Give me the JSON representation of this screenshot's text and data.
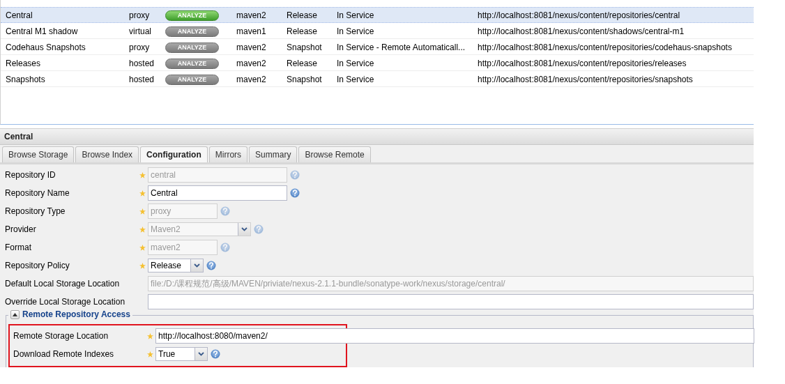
{
  "grid": {
    "rows": [
      {
        "name": "Central",
        "type": "proxy",
        "analyze": "ANALYZE",
        "format": "maven2",
        "policy": "Release",
        "status": "In Service",
        "url": "http://localhost:8081/nexus/content/repositories/central",
        "selected": true
      },
      {
        "name": "Central M1 shadow",
        "type": "virtual",
        "analyze": "ANALYZE",
        "format": "maven1",
        "policy": "Release",
        "status": "In Service",
        "url": "http://localhost:8081/nexus/content/shadows/central-m1",
        "selected": false
      },
      {
        "name": "Codehaus Snapshots",
        "type": "proxy",
        "analyze": "ANALYZE",
        "format": "maven2",
        "policy": "Snapshot",
        "status": "In Service - Remote Automaticall...",
        "url": "http://localhost:8081/nexus/content/repositories/codehaus-snapshots",
        "selected": false
      },
      {
        "name": "Releases",
        "type": "hosted",
        "analyze": "ANALYZE",
        "format": "maven2",
        "policy": "Release",
        "status": "In Service",
        "url": "http://localhost:8081/nexus/content/repositories/releases",
        "selected": false
      },
      {
        "name": "Snapshots",
        "type": "hosted",
        "analyze": "ANALYZE",
        "format": "maven2",
        "policy": "Snapshot",
        "status": "In Service",
        "url": "http://localhost:8081/nexus/content/repositories/snapshots",
        "selected": false
      }
    ]
  },
  "panel": {
    "title": "Central",
    "tabs": [
      {
        "label": "Browse Storage",
        "selected": false
      },
      {
        "label": "Browse Index",
        "selected": false
      },
      {
        "label": "Configuration",
        "selected": true
      },
      {
        "label": "Mirrors",
        "selected": false
      },
      {
        "label": "Summary",
        "selected": false
      },
      {
        "label": "Browse Remote",
        "selected": false
      }
    ],
    "fields": [
      {
        "label": "Repository ID",
        "kind": "text",
        "required": true,
        "disabled": true,
        "value": "central",
        "help": true
      },
      {
        "label": "Repository Name",
        "kind": "text",
        "required": true,
        "disabled": false,
        "value": "Central",
        "help": true
      },
      {
        "label": "Repository Type",
        "kind": "text",
        "required": true,
        "disabled": true,
        "value": "proxy",
        "help": true
      },
      {
        "label": "Provider",
        "kind": "select",
        "required": true,
        "disabled": true,
        "value": "Maven2",
        "help": true
      },
      {
        "label": "Format",
        "kind": "text",
        "required": true,
        "disabled": true,
        "value": "maven2",
        "help": true
      },
      {
        "label": "Repository Policy",
        "kind": "select",
        "required": true,
        "disabled": false,
        "value": "Release",
        "help": true
      },
      {
        "label": "Default Local Storage Location",
        "kind": "text",
        "required": false,
        "disabled": true,
        "value": "file:/D:/课程规范/高级/MAVEN/priviate/nexus-2.1.1-bundle/sonatype-work/nexus/storage/central/",
        "help": false
      },
      {
        "label": "Override Local Storage Location",
        "kind": "text",
        "required": false,
        "disabled": false,
        "help": false
      }
    ],
    "section": {
      "title": "Remote Repository Access",
      "expanded": true,
      "highlighted": true,
      "fields": [
        {
          "label": "Remote Storage Location",
          "kind": "text",
          "required": true,
          "disabled": false,
          "value": "http://localhost:8080/maven2/",
          "help": false
        },
        {
          "label": "Download Remote Indexes",
          "kind": "select",
          "required": true,
          "disabled": false,
          "value": "True",
          "help": true
        }
      ]
    }
  }
}
